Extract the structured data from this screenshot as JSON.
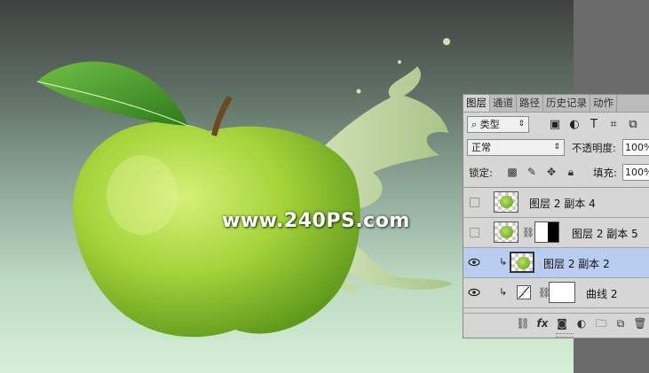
{
  "watermark": "www.240PS.com",
  "panel": {
    "tabs": [
      "图层",
      "通道",
      "路径",
      "历史记录",
      "动作"
    ],
    "active_tab": "图层",
    "kind_filter": "类型",
    "filter_icons": [
      "image-filter-icon",
      "adjustment-filter-icon",
      "type-filter-icon",
      "shape-filter-icon",
      "smart-object-filter-icon"
    ],
    "blend_mode": "正常",
    "opacity_label": "不透明度:",
    "opacity_value": "100%",
    "lock_label": "锁定:",
    "lock_icons": [
      "lock-transparent-icon",
      "lock-image-icon",
      "lock-position-icon",
      "lock-all-icon"
    ],
    "fill_label": "填充:",
    "fill_value": "100%",
    "layers": [
      {
        "name": "图层 2 副本 4",
        "visible": false,
        "selected": false,
        "has_mask": false,
        "clipped": false
      },
      {
        "name": "图层 2 副本 5",
        "visible": false,
        "selected": false,
        "has_mask": true,
        "clipped": false
      },
      {
        "name": "图层 2 副本 2",
        "visible": true,
        "selected": true,
        "has_mask": false,
        "clipped": true
      },
      {
        "name": "曲线 2",
        "visible": true,
        "selected": false,
        "has_mask": true,
        "clipped": true,
        "type": "curves-adjustment"
      }
    ],
    "bottom_icons": [
      "link-layers-icon",
      "fx-icon",
      "add-mask-icon",
      "new-adjustment-icon",
      "new-group-icon",
      "new-layer-icon",
      "delete-layer-icon"
    ],
    "fx_label": "fx",
    "colors": {
      "selected_row": "#b9cdf0",
      "panel_bg": "#d6d6d6"
    }
  }
}
